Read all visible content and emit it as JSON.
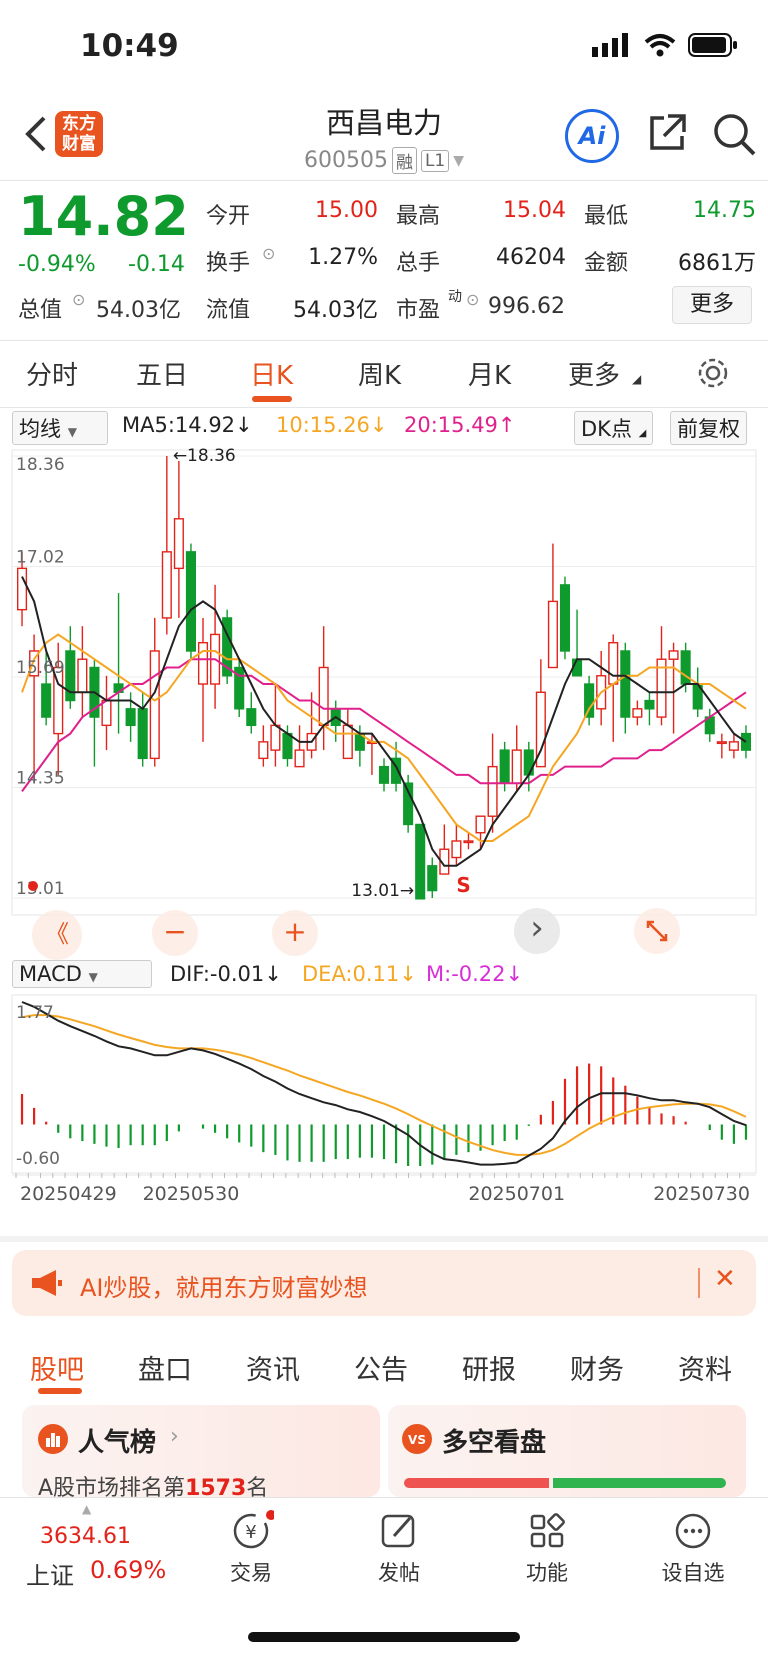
{
  "status_bar": {
    "time": "10:49"
  },
  "header": {
    "logo_line1": "东方",
    "logo_line2": "财富",
    "stock_name": "西昌电力",
    "stock_code": "600505",
    "tag_margin": "融",
    "tag_level": "L1",
    "ai_label": "Ai"
  },
  "quote": {
    "price": "14.82",
    "change_pct": "-0.94%",
    "change_val": "-0.14",
    "open_label": "今开",
    "open": "15.00",
    "high_label": "最高",
    "high": "15.04",
    "low_label": "最低",
    "low": "14.75",
    "turnover_label": "换手",
    "turnover": "1.27%",
    "volume_label": "总手",
    "volume": "46204",
    "amount_label": "金额",
    "amount": "6861万",
    "mktcap_label": "总值",
    "mktcap": "54.03亿",
    "float_label": "流值",
    "float": "54.03亿",
    "pe_label": "市盈",
    "pe_sup": "动",
    "pe": "996.62",
    "more_label": "更多"
  },
  "period_tabs": [
    "分时",
    "五日",
    "日K",
    "周K",
    "月K",
    "更多"
  ],
  "ma": {
    "selector": "均线",
    "ma5": "MA5:14.92↓",
    "ma10": "10:15.26↓",
    "ma20": "20:15.49↑",
    "dk": "DK点",
    "adjust": "前复权"
  },
  "colors": {
    "up": "#e2231a",
    "down": "#0f9a2d",
    "ma5": "#222222",
    "ma10": "#f5a623",
    "ma20": "#e0208c",
    "accent": "#e8531f"
  },
  "chart_data": [
    {
      "type": "candlestick",
      "y_axis_labels": [
        "18.36",
        "17.02",
        "15.69",
        "14.35",
        "13.01"
      ],
      "ylim": [
        13.01,
        18.36
      ],
      "max_marker": "←18.36",
      "min_marker": "13.01→",
      "signal": "S",
      "candles": [
        [
          16.5,
          17.0,
          17.2,
          16.3
        ],
        [
          15.7,
          16.0,
          16.2,
          14.4
        ],
        [
          15.6,
          15.2,
          16.0,
          15.1
        ],
        [
          15.0,
          15.8,
          16.1,
          14.5
        ],
        [
          16.0,
          15.4,
          16.3,
          15.3
        ],
        [
          15.5,
          15.9,
          16.3,
          15.2
        ],
        [
          15.8,
          15.2,
          15.9,
          14.6
        ],
        [
          15.1,
          15.4,
          15.7,
          14.8
        ],
        [
          15.6,
          15.5,
          16.7,
          15.0
        ],
        [
          15.3,
          15.1,
          15.5,
          14.9
        ],
        [
          15.3,
          14.7,
          15.5,
          14.6
        ],
        [
          14.7,
          16.0,
          16.4,
          14.6
        ],
        [
          16.4,
          17.2,
          18.36,
          16.2
        ],
        [
          17.0,
          17.6,
          18.3,
          16.4
        ],
        [
          17.2,
          16.0,
          17.3,
          15.9
        ],
        [
          15.6,
          16.1,
          16.4,
          14.9
        ],
        [
          15.6,
          16.2,
          16.8,
          15.3
        ],
        [
          16.4,
          15.7,
          16.5,
          15.6
        ],
        [
          15.8,
          15.3,
          15.9,
          15.2
        ],
        [
          15.3,
          15.1,
          15.5,
          15.0
        ],
        [
          14.7,
          14.9,
          15.1,
          14.6
        ],
        [
          14.8,
          15.1,
          15.6,
          14.6
        ],
        [
          15.0,
          14.7,
          15.1,
          14.6
        ],
        [
          14.6,
          14.8,
          15.1,
          14.6
        ],
        [
          14.8,
          15.0,
          15.5,
          14.7
        ],
        [
          15.1,
          15.8,
          16.3,
          14.8
        ],
        [
          15.3,
          15.1,
          15.4,
          14.9
        ],
        [
          14.7,
          15.1,
          15.3,
          14.7
        ],
        [
          15.0,
          14.8,
          15.1,
          14.6
        ],
        [
          14.9,
          14.9,
          15.0,
          14.5
        ],
        [
          14.6,
          14.4,
          14.7,
          14.3
        ],
        [
          14.7,
          14.4,
          14.9,
          14.3
        ],
        [
          14.4,
          13.9,
          14.5,
          13.8
        ],
        [
          13.9,
          13.0,
          13.9,
          13.01
        ],
        [
          13.4,
          13.1,
          13.5,
          13.01
        ],
        [
          13.3,
          13.6,
          13.9,
          13.3
        ],
        [
          13.5,
          13.7,
          13.9,
          13.4
        ],
        [
          13.7,
          13.7,
          13.8,
          13.6
        ],
        [
          13.8,
          14.0,
          14.0,
          13.6
        ],
        [
          14.0,
          14.6,
          15.0,
          13.8
        ],
        [
          14.8,
          14.4,
          14.9,
          14.3
        ],
        [
          14.4,
          14.8,
          15.1,
          14.3
        ],
        [
          14.8,
          14.5,
          14.9,
          14.3
        ],
        [
          14.6,
          15.5,
          15.9,
          14.6
        ],
        [
          15.8,
          16.6,
          17.3,
          15.8
        ],
        [
          16.8,
          16.0,
          16.9,
          15.9
        ],
        [
          15.9,
          15.7,
          16.5,
          15.7
        ],
        [
          15.6,
          15.2,
          15.7,
          15.1
        ],
        [
          15.3,
          15.7,
          16.0,
          15.1
        ],
        [
          15.6,
          16.1,
          16.2,
          14.9
        ],
        [
          16.0,
          15.2,
          16.1,
          15.0
        ],
        [
          15.2,
          15.3,
          15.4,
          15.1
        ],
        [
          15.4,
          15.3,
          15.5,
          15.1
        ],
        [
          15.2,
          15.9,
          16.3,
          15.1
        ],
        [
          15.9,
          16.0,
          16.1,
          15.0
        ],
        [
          16.0,
          15.6,
          16.1,
          15.5
        ],
        [
          15.6,
          15.3,
          15.8,
          15.2
        ],
        [
          15.2,
          15.0,
          15.3,
          14.9
        ],
        [
          14.9,
          14.9,
          15.0,
          14.7
        ],
        [
          14.8,
          14.9,
          15.0,
          14.7
        ],
        [
          15.0,
          14.8,
          15.1,
          14.7
        ]
      ],
      "ma5": [
        16.9,
        16.6,
        16.0,
        15.6,
        15.5,
        15.5,
        15.5,
        15.4,
        15.4,
        15.4,
        15.3,
        15.5,
        15.9,
        16.3,
        16.5,
        16.6,
        16.5,
        16.2,
        15.9,
        15.6,
        15.3,
        15.1,
        15.0,
        14.9,
        14.9,
        15.1,
        15.2,
        15.1,
        15.0,
        15.0,
        14.8,
        14.6,
        14.3,
        14.0,
        13.6,
        13.4,
        13.4,
        13.5,
        13.6,
        13.9,
        14.1,
        14.3,
        14.5,
        14.8,
        15.2,
        15.6,
        15.9,
        15.9,
        15.8,
        15.7,
        15.7,
        15.6,
        15.5,
        15.5,
        15.5,
        15.6,
        15.6,
        15.4,
        15.2,
        15.0,
        14.9
      ],
      "ma10": [
        15.5,
        15.9,
        16.1,
        16.2,
        16.1,
        16.0,
        15.9,
        15.8,
        15.7,
        15.6,
        15.5,
        15.4,
        15.5,
        15.7,
        15.9,
        16.0,
        16.0,
        15.9,
        15.9,
        15.8,
        15.7,
        15.6,
        15.4,
        15.3,
        15.2,
        15.1,
        15.0,
        15.0,
        15.0,
        14.9,
        14.9,
        14.8,
        14.7,
        14.5,
        14.3,
        14.1,
        13.9,
        13.8,
        13.7,
        13.7,
        13.8,
        13.9,
        14.0,
        14.3,
        14.6,
        14.8,
        15.0,
        15.3,
        15.5,
        15.6,
        15.7,
        15.7,
        15.8,
        15.8,
        15.8,
        15.7,
        15.6,
        15.6,
        15.5,
        15.4,
        15.3
      ],
      "ma20": [
        14.3,
        14.5,
        14.7,
        14.9,
        15.0,
        15.2,
        15.3,
        15.4,
        15.5,
        15.6,
        15.6,
        15.7,
        15.8,
        15.8,
        15.9,
        15.9,
        15.9,
        15.8,
        15.7,
        15.7,
        15.6,
        15.6,
        15.5,
        15.4,
        15.4,
        15.3,
        15.3,
        15.3,
        15.3,
        15.2,
        15.1,
        15.0,
        14.9,
        14.8,
        14.7,
        14.6,
        14.5,
        14.5,
        14.4,
        14.4,
        14.4,
        14.4,
        14.4,
        14.5,
        14.5,
        14.6,
        14.6,
        14.6,
        14.6,
        14.7,
        14.7,
        14.7,
        14.8,
        14.8,
        14.9,
        15.0,
        15.1,
        15.2,
        15.3,
        15.4,
        15.5
      ]
    },
    {
      "type": "macd",
      "indicator": "MACD",
      "dif_label": "DIF:-0.01↓",
      "dea_label": "DEA:0.11↓",
      "m_label": "M:-0.22↓",
      "y_axis_labels": [
        "1.77",
        "-0.60"
      ],
      "ylim": [
        -0.6,
        1.77
      ],
      "x_ticks": [
        "20250429",
        "20250530",
        "20250701",
        "20250730"
      ],
      "dif": [
        1.77,
        1.7,
        1.6,
        1.5,
        1.42,
        1.35,
        1.28,
        1.2,
        1.13,
        1.1,
        1.05,
        1.0,
        1.0,
        1.05,
        1.1,
        1.07,
        1.02,
        0.95,
        0.88,
        0.8,
        0.7,
        0.62,
        0.52,
        0.44,
        0.38,
        0.32,
        0.28,
        0.22,
        0.18,
        0.12,
        0.05,
        -0.05,
        -0.15,
        -0.3,
        -0.42,
        -0.5,
        -0.52,
        -0.55,
        -0.58,
        -0.58,
        -0.57,
        -0.55,
        -0.45,
        -0.35,
        -0.2,
        0.05,
        0.25,
        0.38,
        0.45,
        0.45,
        0.45,
        0.42,
        0.38,
        0.35,
        0.35,
        0.32,
        0.3,
        0.25,
        0.15,
        0.05,
        -0.01
      ],
      "dea": [
        1.55,
        1.58,
        1.58,
        1.56,
        1.52,
        1.47,
        1.42,
        1.36,
        1.3,
        1.25,
        1.2,
        1.15,
        1.12,
        1.1,
        1.1,
        1.1,
        1.08,
        1.05,
        1.01,
        0.96,
        0.9,
        0.84,
        0.78,
        0.71,
        0.65,
        0.59,
        0.53,
        0.47,
        0.42,
        0.36,
        0.3,
        0.23,
        0.15,
        0.06,
        -0.02,
        -0.1,
        -0.18,
        -0.25,
        -0.31,
        -0.37,
        -0.41,
        -0.44,
        -0.44,
        -0.42,
        -0.37,
        -0.28,
        -0.17,
        -0.06,
        0.03,
        0.11,
        0.17,
        0.22,
        0.25,
        0.27,
        0.29,
        0.3,
        0.3,
        0.29,
        0.26,
        0.19,
        0.11
      ],
      "hist": [
        0.44,
        0.24,
        0.04,
        -0.12,
        -0.2,
        -0.24,
        -0.28,
        -0.32,
        -0.34,
        -0.3,
        -0.3,
        -0.3,
        -0.24,
        -0.1,
        0.0,
        -0.06,
        -0.12,
        -0.2,
        -0.26,
        -0.32,
        -0.4,
        -0.44,
        -0.52,
        -0.54,
        -0.54,
        -0.54,
        -0.5,
        -0.5,
        -0.48,
        -0.48,
        -0.5,
        -0.56,
        -0.6,
        -0.6,
        -0.58,
        -0.5,
        -0.44,
        -0.4,
        -0.38,
        -0.3,
        -0.24,
        -0.22,
        -0.02,
        0.14,
        0.34,
        0.66,
        0.84,
        0.88,
        0.84,
        0.68,
        0.56,
        0.4,
        0.26,
        0.16,
        0.12,
        0.04,
        0.0,
        -0.08,
        -0.22,
        -0.28,
        -0.22
      ]
    }
  ],
  "chart_controls": {
    "prev": "《",
    "zoom_out": "−",
    "zoom_in": "+",
    "next": "›"
  },
  "banner": {
    "text": "AI炒股，就用东方财富妙想"
  },
  "content_tabs": [
    "股吧",
    "盘口",
    "资讯",
    "公告",
    "研报",
    "财务",
    "资料"
  ],
  "cards": {
    "popularity_title": "人气榜",
    "popularity_rank_prefix": "A股市场排名第",
    "popularity_rank": "1573",
    "popularity_rank_suffix": "名",
    "longshort_title": "多空看盘"
  },
  "bottom_nav": {
    "index_value": "3634.61",
    "index_name": "上证",
    "index_change": "0.69%",
    "trade": "交易",
    "post": "发帖",
    "functions": "功能",
    "watchlist": "设自选"
  }
}
